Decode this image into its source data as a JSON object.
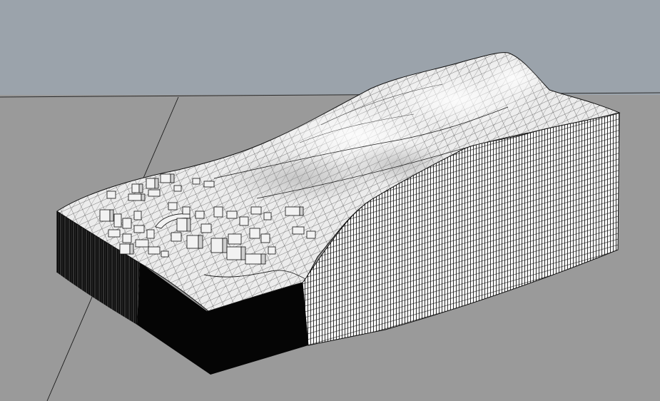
{
  "viewport": {
    "view": "perspective",
    "model": "terrain-mesh-with-buildings",
    "colors": {
      "sky": "#9ba3ab",
      "ground": "#9a9a9a",
      "horizon_line": "#2a2a2a",
      "terrain_surface": "#e9e9e9",
      "terrain_highlight": "#f7f7f7",
      "mesh_line": "#1e1e1e",
      "base_side_dark": "#050505",
      "building_face": "#f2f2f2",
      "building_edge": "#111111"
    }
  }
}
